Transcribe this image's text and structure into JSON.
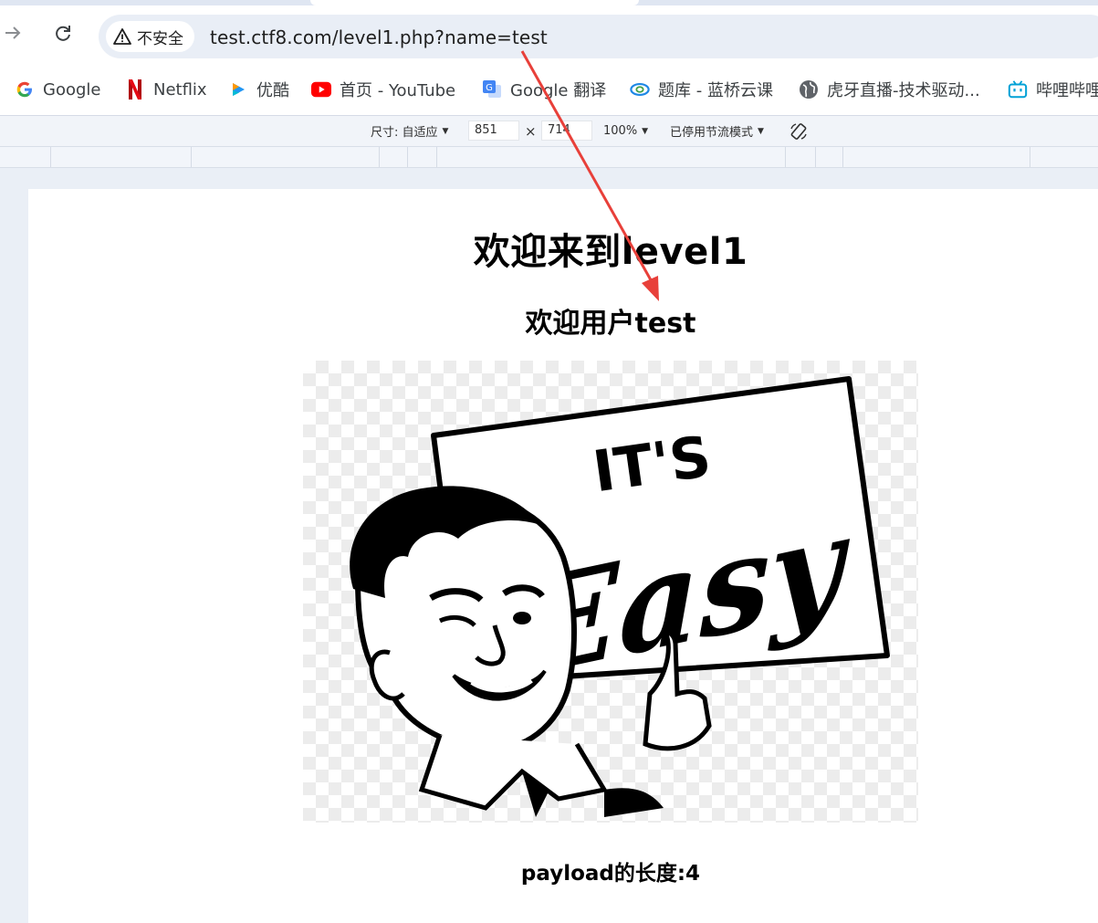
{
  "browser": {
    "security_chip_label": "不安全",
    "url": "test.ctf8.com/level1.php?name=test",
    "bookmarks": [
      {
        "label": "Google",
        "icon": "google-g-icon"
      },
      {
        "label": "Netflix",
        "icon": "netflix-n-icon"
      },
      {
        "label": "优酷",
        "icon": "youku-play-icon"
      },
      {
        "label": "首页 - YouTube",
        "icon": "youtube-play-icon"
      },
      {
        "label": "Google 翻译",
        "icon": "google-translate-icon"
      },
      {
        "label": "题库 - 蓝桥云课",
        "icon": "lanqiao-logo-icon"
      },
      {
        "label": "虎牙直播-技术驱动...",
        "icon": "globe-icon"
      },
      {
        "label": "哔哩哔哩",
        "icon": "bilibili-tv-icon"
      }
    ]
  },
  "device_toolbar": {
    "dimensions_label": "尺寸: 自适应",
    "width": "851",
    "times": "×",
    "height": "714",
    "zoom": "100%",
    "throttle": "已停用节流模式"
  },
  "page": {
    "heading": "欢迎来到level1",
    "welcome_user": "欢迎用户test",
    "image_text_top": "IT'S",
    "image_text_main": "Easy",
    "payload_length": "payload的长度:4"
  },
  "colors": {
    "arrow": "#e8403a",
    "omnibox_bg": "#e9eef6",
    "viewport_bg": "#eaeff6"
  }
}
